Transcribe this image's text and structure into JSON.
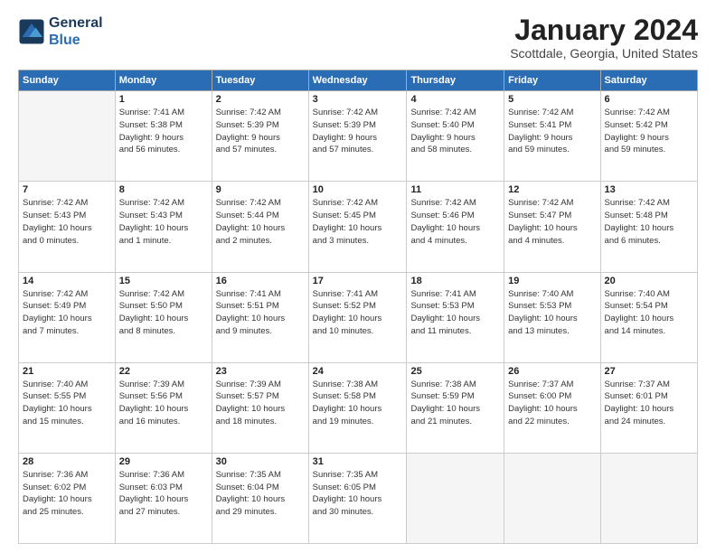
{
  "logo": {
    "line1": "General",
    "line2": "Blue"
  },
  "title": "January 2024",
  "location": "Scottdale, Georgia, United States",
  "days_header": [
    "Sunday",
    "Monday",
    "Tuesday",
    "Wednesday",
    "Thursday",
    "Friday",
    "Saturday"
  ],
  "weeks": [
    [
      {
        "num": "",
        "info": ""
      },
      {
        "num": "1",
        "info": "Sunrise: 7:41 AM\nSunset: 5:38 PM\nDaylight: 9 hours\nand 56 minutes."
      },
      {
        "num": "2",
        "info": "Sunrise: 7:42 AM\nSunset: 5:39 PM\nDaylight: 9 hours\nand 57 minutes."
      },
      {
        "num": "3",
        "info": "Sunrise: 7:42 AM\nSunset: 5:39 PM\nDaylight: 9 hours\nand 57 minutes."
      },
      {
        "num": "4",
        "info": "Sunrise: 7:42 AM\nSunset: 5:40 PM\nDaylight: 9 hours\nand 58 minutes."
      },
      {
        "num": "5",
        "info": "Sunrise: 7:42 AM\nSunset: 5:41 PM\nDaylight: 9 hours\nand 59 minutes."
      },
      {
        "num": "6",
        "info": "Sunrise: 7:42 AM\nSunset: 5:42 PM\nDaylight: 9 hours\nand 59 minutes."
      }
    ],
    [
      {
        "num": "7",
        "info": "Sunrise: 7:42 AM\nSunset: 5:43 PM\nDaylight: 10 hours\nand 0 minutes."
      },
      {
        "num": "8",
        "info": "Sunrise: 7:42 AM\nSunset: 5:43 PM\nDaylight: 10 hours\nand 1 minute."
      },
      {
        "num": "9",
        "info": "Sunrise: 7:42 AM\nSunset: 5:44 PM\nDaylight: 10 hours\nand 2 minutes."
      },
      {
        "num": "10",
        "info": "Sunrise: 7:42 AM\nSunset: 5:45 PM\nDaylight: 10 hours\nand 3 minutes."
      },
      {
        "num": "11",
        "info": "Sunrise: 7:42 AM\nSunset: 5:46 PM\nDaylight: 10 hours\nand 4 minutes."
      },
      {
        "num": "12",
        "info": "Sunrise: 7:42 AM\nSunset: 5:47 PM\nDaylight: 10 hours\nand 4 minutes."
      },
      {
        "num": "13",
        "info": "Sunrise: 7:42 AM\nSunset: 5:48 PM\nDaylight: 10 hours\nand 6 minutes."
      }
    ],
    [
      {
        "num": "14",
        "info": "Sunrise: 7:42 AM\nSunset: 5:49 PM\nDaylight: 10 hours\nand 7 minutes."
      },
      {
        "num": "15",
        "info": "Sunrise: 7:42 AM\nSunset: 5:50 PM\nDaylight: 10 hours\nand 8 minutes."
      },
      {
        "num": "16",
        "info": "Sunrise: 7:41 AM\nSunset: 5:51 PM\nDaylight: 10 hours\nand 9 minutes."
      },
      {
        "num": "17",
        "info": "Sunrise: 7:41 AM\nSunset: 5:52 PM\nDaylight: 10 hours\nand 10 minutes."
      },
      {
        "num": "18",
        "info": "Sunrise: 7:41 AM\nSunset: 5:53 PM\nDaylight: 10 hours\nand 11 minutes."
      },
      {
        "num": "19",
        "info": "Sunrise: 7:40 AM\nSunset: 5:53 PM\nDaylight: 10 hours\nand 13 minutes."
      },
      {
        "num": "20",
        "info": "Sunrise: 7:40 AM\nSunset: 5:54 PM\nDaylight: 10 hours\nand 14 minutes."
      }
    ],
    [
      {
        "num": "21",
        "info": "Sunrise: 7:40 AM\nSunset: 5:55 PM\nDaylight: 10 hours\nand 15 minutes."
      },
      {
        "num": "22",
        "info": "Sunrise: 7:39 AM\nSunset: 5:56 PM\nDaylight: 10 hours\nand 16 minutes."
      },
      {
        "num": "23",
        "info": "Sunrise: 7:39 AM\nSunset: 5:57 PM\nDaylight: 10 hours\nand 18 minutes."
      },
      {
        "num": "24",
        "info": "Sunrise: 7:38 AM\nSunset: 5:58 PM\nDaylight: 10 hours\nand 19 minutes."
      },
      {
        "num": "25",
        "info": "Sunrise: 7:38 AM\nSunset: 5:59 PM\nDaylight: 10 hours\nand 21 minutes."
      },
      {
        "num": "26",
        "info": "Sunrise: 7:37 AM\nSunset: 6:00 PM\nDaylight: 10 hours\nand 22 minutes."
      },
      {
        "num": "27",
        "info": "Sunrise: 7:37 AM\nSunset: 6:01 PM\nDaylight: 10 hours\nand 24 minutes."
      }
    ],
    [
      {
        "num": "28",
        "info": "Sunrise: 7:36 AM\nSunset: 6:02 PM\nDaylight: 10 hours\nand 25 minutes."
      },
      {
        "num": "29",
        "info": "Sunrise: 7:36 AM\nSunset: 6:03 PM\nDaylight: 10 hours\nand 27 minutes."
      },
      {
        "num": "30",
        "info": "Sunrise: 7:35 AM\nSunset: 6:04 PM\nDaylight: 10 hours\nand 29 minutes."
      },
      {
        "num": "31",
        "info": "Sunrise: 7:35 AM\nSunset: 6:05 PM\nDaylight: 10 hours\nand 30 minutes."
      },
      {
        "num": "",
        "info": ""
      },
      {
        "num": "",
        "info": ""
      },
      {
        "num": "",
        "info": ""
      }
    ]
  ]
}
